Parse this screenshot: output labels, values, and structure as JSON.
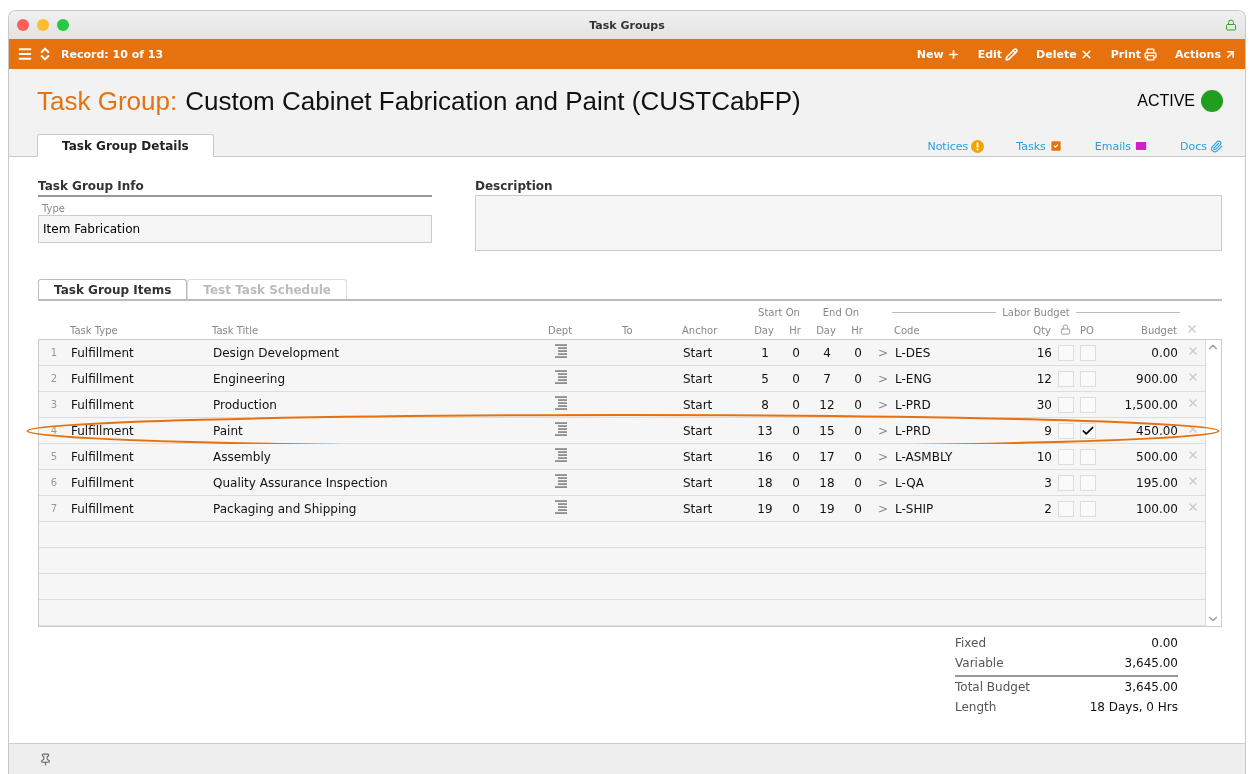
{
  "window": {
    "title": "Task Groups"
  },
  "toolbar": {
    "record": "Record: 10 of 13",
    "actions": [
      {
        "label": "New",
        "kind": "new"
      },
      {
        "label": "Edit",
        "kind": "edit"
      },
      {
        "label": "Delete",
        "kind": "delete"
      },
      {
        "label": "Print",
        "kind": "print"
      },
      {
        "label": "Actions",
        "kind": "actions"
      }
    ]
  },
  "header": {
    "prefix": "Task Group:",
    "name": "Custom Cabinet Fabrication and Paint  (CUSTCabFP)",
    "status": "ACTIVE"
  },
  "tabs": [
    {
      "label": "Task Group Details",
      "selected": true
    }
  ],
  "links": [
    {
      "label": "Notices",
      "kind": "notices"
    },
    {
      "label": "Tasks",
      "kind": "tasks"
    },
    {
      "label": "Emails",
      "kind": "emails"
    },
    {
      "label": "Docs",
      "kind": "docs"
    }
  ],
  "info": {
    "heading": "Task Group Info",
    "type_label": "Type",
    "type_value": "Item Fabrication"
  },
  "description": {
    "heading": "Description"
  },
  "item_tabs": [
    {
      "label": "Task Group Items",
      "selected": true
    },
    {
      "label": "Test Task Schedule",
      "selected": false
    }
  ],
  "table": {
    "group_headers": {
      "start_on": "Start On",
      "end_on": "End On",
      "labor_budget": "Labor Budget"
    },
    "header_cells": [
      {
        "kind": "blank"
      },
      {
        "kind": "text",
        "label": "Task Type"
      },
      {
        "kind": "text",
        "label": "Task Title"
      },
      {
        "kind": "center",
        "label": "Dept"
      },
      {
        "kind": "text",
        "label": "To"
      },
      {
        "kind": "text",
        "label": "Anchor"
      },
      {
        "kind": "center",
        "label": "Day"
      },
      {
        "kind": "center",
        "label": "Hr"
      },
      {
        "kind": "center",
        "label": "Day"
      },
      {
        "kind": "center",
        "label": "Hr"
      },
      {
        "kind": "blank"
      },
      {
        "kind": "text",
        "label": "Code"
      },
      {
        "kind": "right",
        "label": "Qty"
      },
      {
        "kind": "lock"
      },
      {
        "kind": "center",
        "label": "PO"
      },
      {
        "kind": "right",
        "label": "Budget"
      },
      {
        "kind": "delete"
      }
    ],
    "rows": [
      {
        "number": "1",
        "task_type": "Fulfillment",
        "task_title": "Design Development",
        "anchor": "Start",
        "start_day": "1",
        "start_hr": "0",
        "end_day": "4",
        "end_hr": "0",
        "arrow": ">",
        "code": "L-DES",
        "qty": "16",
        "locked": false,
        "po": false,
        "budget": "0.00",
        "highlighted": false
      },
      {
        "number": "2",
        "task_type": "Fulfillment",
        "task_title": "Engineering",
        "anchor": "Start",
        "start_day": "5",
        "start_hr": "0",
        "end_day": "7",
        "end_hr": "0",
        "arrow": ">",
        "code": "L-ENG",
        "qty": "12",
        "locked": false,
        "po": false,
        "budget": "900.00",
        "highlighted": false
      },
      {
        "number": "3",
        "task_type": "Fulfillment",
        "task_title": "Production",
        "anchor": "Start",
        "start_day": "8",
        "start_hr": "0",
        "end_day": "12",
        "end_hr": "0",
        "arrow": ">",
        "code": "L-PRD",
        "qty": "30",
        "locked": false,
        "po": false,
        "budget": "1,500.00",
        "highlighted": false
      },
      {
        "number": "4",
        "task_type": "Fulfillment",
        "task_title": "Paint",
        "anchor": "Start",
        "start_day": "13",
        "start_hr": "0",
        "end_day": "15",
        "end_hr": "0",
        "arrow": ">",
        "code": "L-PRD",
        "qty": "9",
        "locked": false,
        "po": true,
        "budget": "450.00",
        "highlighted": true
      },
      {
        "number": "5",
        "task_type": "Fulfillment",
        "task_title": "Assembly",
        "anchor": "Start",
        "start_day": "16",
        "start_hr": "0",
        "end_day": "17",
        "end_hr": "0",
        "arrow": ">",
        "code": "L-ASMBLY",
        "qty": "10",
        "locked": false,
        "po": false,
        "budget": "500.00",
        "highlighted": false
      },
      {
        "number": "6",
        "task_type": "Fulfillment",
        "task_title": "Quality Assurance Inspection",
        "anchor": "Start",
        "start_day": "18",
        "start_hr": "0",
        "end_day": "18",
        "end_hr": "0",
        "arrow": ">",
        "code": "L-QA",
        "qty": "3",
        "locked": false,
        "po": false,
        "budget": "195.00",
        "highlighted": false
      },
      {
        "number": "7",
        "task_type": "Fulfillment",
        "task_title": "Packaging and Shipping",
        "anchor": "Start",
        "start_day": "19",
        "start_hr": "0",
        "end_day": "19",
        "end_hr": "0",
        "arrow": ">",
        "code": "L-SHIP",
        "qty": "2",
        "locked": false,
        "po": false,
        "budget": "100.00",
        "highlighted": false
      }
    ]
  },
  "summary": [
    {
      "label": "Fixed",
      "value": "0.00",
      "kind": "plain"
    },
    {
      "label": "Variable",
      "value": "3,645.00",
      "kind": "plain"
    },
    {
      "label": "Total Budget",
      "value": "3,645.00",
      "kind": "total"
    },
    {
      "label": "Length",
      "value": "18 Days, 0 Hrs",
      "kind": "plain"
    }
  ]
}
